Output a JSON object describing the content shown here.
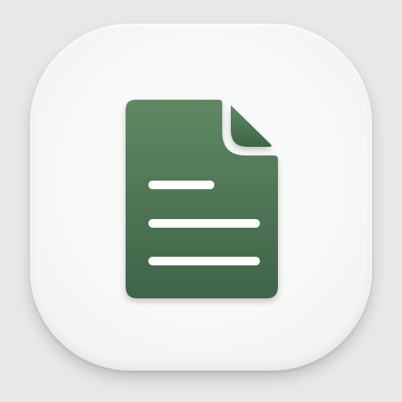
{
  "icon": {
    "name": "document-icon",
    "colors": {
      "background": "#e7e8e8",
      "tile": "#f7f8f7",
      "document_top": "#5f8863",
      "document_bottom": "#3e6448",
      "text_lines": "#ffffff"
    }
  }
}
